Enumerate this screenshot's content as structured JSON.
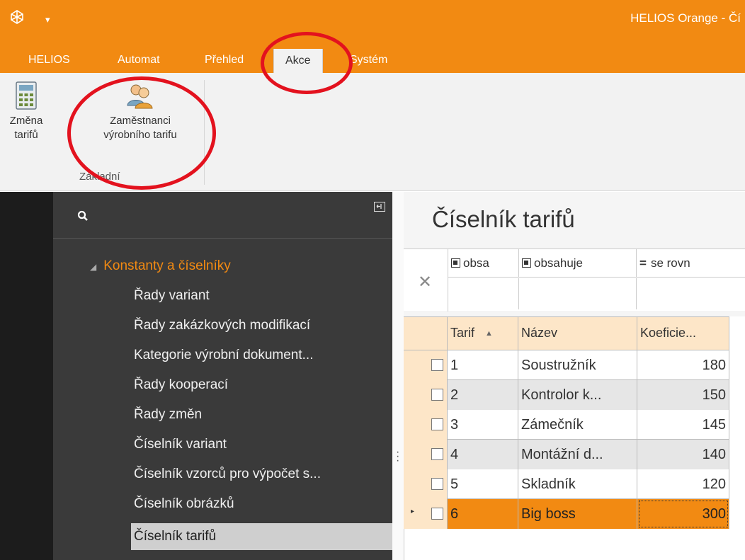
{
  "window": {
    "title": "HELIOS Orange - Čí",
    "quick_access_symbol": "▾"
  },
  "ribbon": {
    "tabs": [
      {
        "label": "HELIOS"
      },
      {
        "label": "Automat"
      },
      {
        "label": "Přehled"
      },
      {
        "label": "Akce"
      },
      {
        "label": "Systém"
      }
    ],
    "active_tab": "Akce",
    "buttons": [
      {
        "line1": "Změna",
        "line2": "tarifů",
        "icon": "calculator-icon"
      },
      {
        "line1": "Zaměstnanci",
        "line2": "výrobního tarifu",
        "icon": "people-icon"
      }
    ],
    "group_label": "Základní"
  },
  "nav": {
    "category": "Konstanty a číselníky",
    "expand_symbol": "◢",
    "items": [
      "Řady variant",
      "Řady zakázkových modifikací",
      "Kategorie výrobní dokument...",
      "Řady kooperací",
      "Řady změn",
      "Číselník variant",
      "Číselník vzorců pro výpočet s...",
      "Číselník obrázků",
      "Číselník tarifů"
    ],
    "selected_item": "Číselník tarifů"
  },
  "main": {
    "title": "Číselník tarifů",
    "clear_filter_symbol": "✕",
    "filters": [
      {
        "label": "obsa",
        "icon": "contains-icon"
      },
      {
        "label": "obsahuje",
        "icon": "contains-icon"
      },
      {
        "label": "se rovn",
        "symbol": "="
      }
    ],
    "columns": [
      {
        "label": "Tarif",
        "sort": "▲"
      },
      {
        "label": "Název"
      },
      {
        "label": "Koeficie..."
      }
    ],
    "rows": [
      {
        "tarif": "1",
        "nazev": "Soustružník",
        "koef": "180"
      },
      {
        "tarif": "2",
        "nazev": "Kontrolor k...",
        "koef": "150"
      },
      {
        "tarif": "3",
        "nazev": "Zámečník",
        "koef": "145"
      },
      {
        "tarif": "4",
        "nazev": "Montážní d...",
        "koef": "140"
      },
      {
        "tarif": "5",
        "nazev": "Skladník",
        "koef": "120"
      },
      {
        "tarif": "6",
        "nazev": "Big boss",
        "koef": "300"
      }
    ],
    "selected_row": "6"
  },
  "colors": {
    "accent": "#f28a12",
    "annotation": "#e3121e",
    "nav_bg": "#3a3a3a"
  }
}
